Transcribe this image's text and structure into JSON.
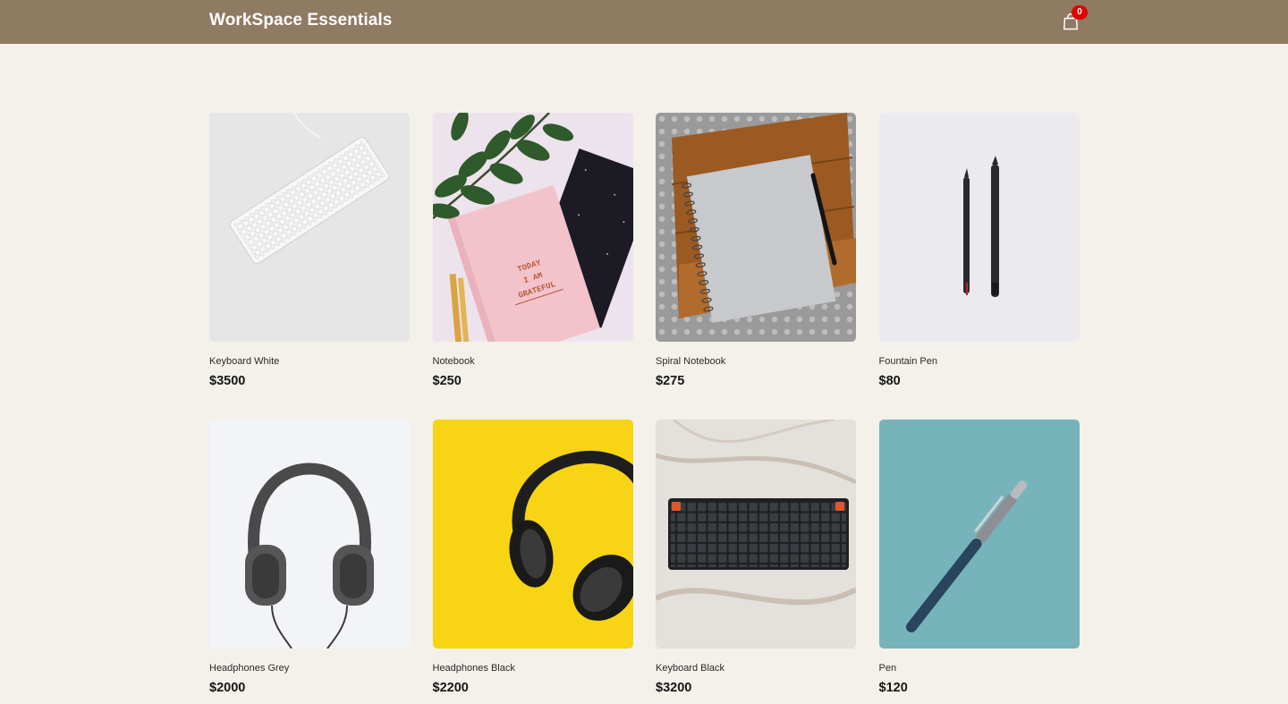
{
  "header": {
    "title": "WorkSpace Essentials",
    "cart_count": "0",
    "cart_icon": "shopping-bag-icon",
    "background": "#8f7a62",
    "badge_color": "#e00000"
  },
  "products": [
    {
      "name": "Keyboard White",
      "price": "$3500",
      "image": "white-keyboard-image"
    },
    {
      "name": "Notebook",
      "price": "$250",
      "image": "pink-notebook-image"
    },
    {
      "name": "Spiral Notebook",
      "price": "$275",
      "image": "spiral-notebook-image"
    },
    {
      "name": "Fountain Pen",
      "price": "$80",
      "image": "black-pens-image"
    },
    {
      "name": "Headphones Grey",
      "price": "$2000",
      "image": "grey-headphones-image"
    },
    {
      "name": "Headphones Black",
      "price": "$2200",
      "image": "black-headphones-yellow-bg-image"
    },
    {
      "name": "Keyboard Black",
      "price": "$3200",
      "image": "black-keyboard-marble-image"
    },
    {
      "name": "Pen",
      "price": "$120",
      "image": "blue-pen-image"
    }
  ],
  "image_texts": {
    "notebook_cover": [
      "TODAY",
      "I AM",
      "GRATEFUL"
    ]
  }
}
